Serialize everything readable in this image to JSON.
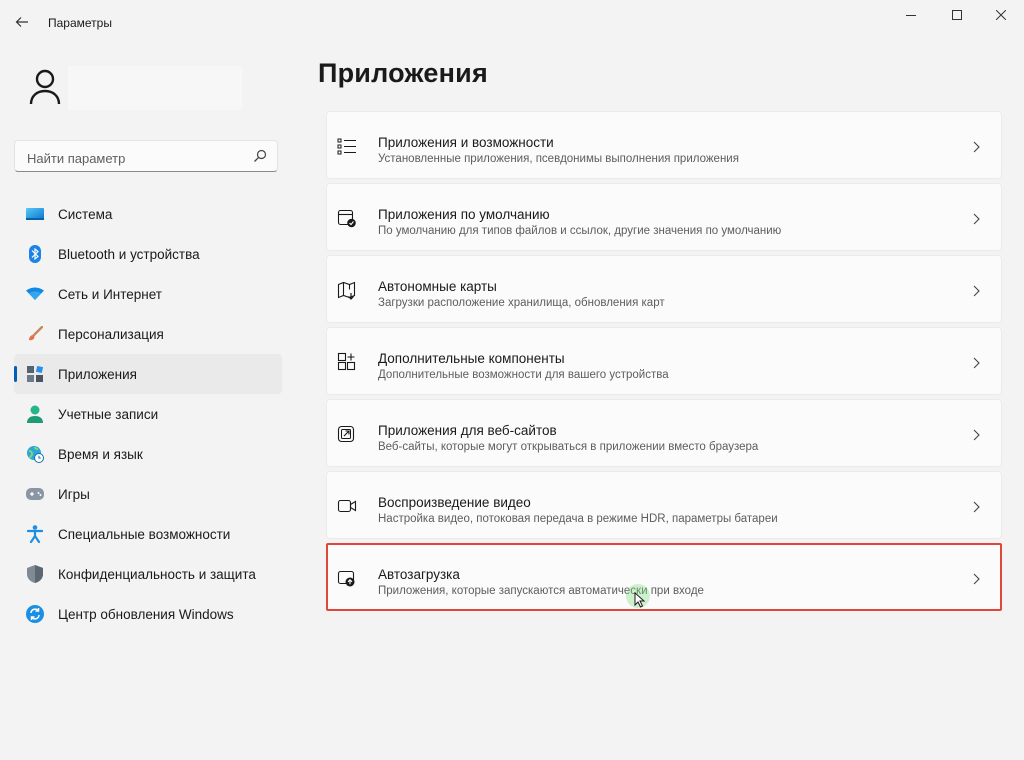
{
  "titlebar": {
    "app_title": "Параметры",
    "icons": {
      "back": "back-arrow-icon",
      "minimize": "minimize-icon",
      "maximize": "maximize-icon",
      "close": "close-icon"
    }
  },
  "profile": {
    "icon": "user-avatar-icon"
  },
  "search": {
    "placeholder": "Найти параметр",
    "value": "",
    "icon": "search-icon"
  },
  "sidebar": {
    "items": [
      {
        "label": "Система",
        "icon": "display-icon"
      },
      {
        "label": "Bluetooth и устройства",
        "icon": "bluetooth-icon"
      },
      {
        "label": "Сеть и Интернет",
        "icon": "wifi-icon"
      },
      {
        "label": "Персонализация",
        "icon": "brush-icon"
      },
      {
        "label": "Приложения",
        "icon": "apps-icon",
        "selected": true
      },
      {
        "label": "Учетные записи",
        "icon": "account-icon"
      },
      {
        "label": "Время и язык",
        "icon": "globe-clock-icon"
      },
      {
        "label": "Игры",
        "icon": "gamepad-icon"
      },
      {
        "label": "Специальные возможности",
        "icon": "accessibility-icon"
      },
      {
        "label": "Конфиденциальность и защита",
        "icon": "shield-icon"
      },
      {
        "label": "Центр обновления Windows",
        "icon": "sync-icon"
      }
    ]
  },
  "main": {
    "title": "Приложения",
    "items": [
      {
        "title": "Приложения и возможности",
        "subtitle": "Установленные приложения, псевдонимы выполнения приложения",
        "icon": "list-icon"
      },
      {
        "title": "Приложения по умолчанию",
        "subtitle": "По умолчанию для типов файлов и ссылок, другие значения по умолчанию",
        "icon": "default-apps-icon"
      },
      {
        "title": "Автономные карты",
        "subtitle": "Загрузки расположение хранилища, обновления карт",
        "icon": "map-icon"
      },
      {
        "title": "Дополнительные компоненты",
        "subtitle": "Дополнительные возможности для вашего устройства",
        "icon": "add-components-icon"
      },
      {
        "title": "Приложения для веб-сайтов",
        "subtitle": "Веб-сайты, которые могут открываться в приложении вместо браузера",
        "icon": "open-link-icon"
      },
      {
        "title": "Воспроизведение видео",
        "subtitle": "Настройка видео, потоковая передача в режиме HDR, параметры батареи",
        "icon": "video-icon"
      },
      {
        "title": "Автозагрузка",
        "subtitle": "Приложения, которые запускаются автоматически при входе",
        "icon": "startup-icon",
        "highlighted": true
      }
    ]
  },
  "colors": {
    "accent": "#005fb8",
    "highlight_border": "#e0463a",
    "background": "#f3f3f3",
    "card": "#fbfbfb"
  }
}
